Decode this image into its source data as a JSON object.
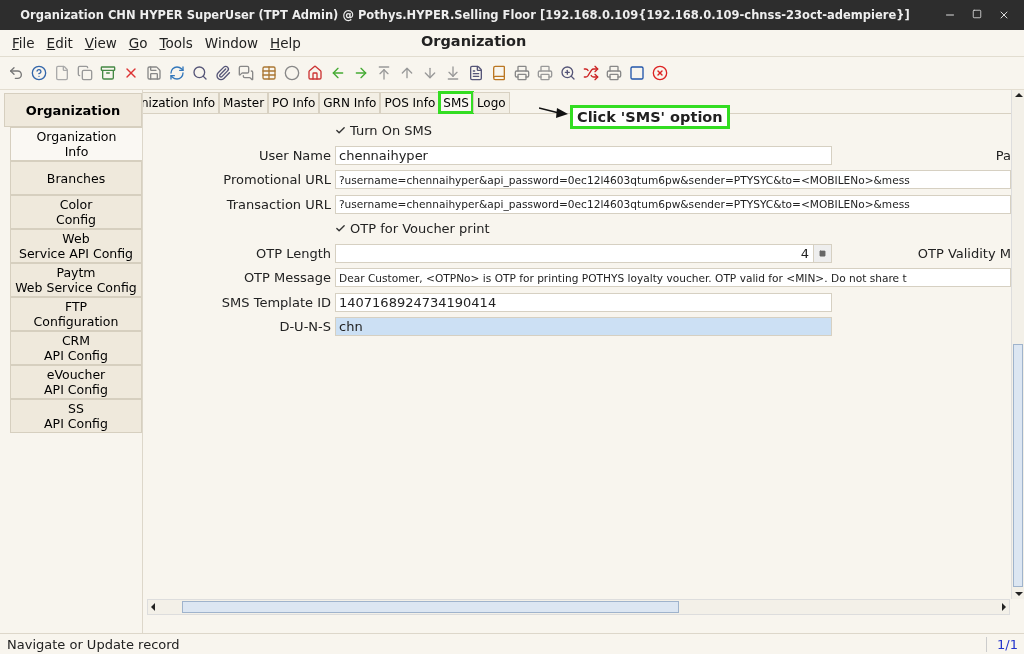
{
  "window": {
    "title": "Organization  CHN  HYPER  SuperUser (TPT Admin) @ Pothys.HYPER.Selling Floor [192.168.0.109{192.168.0.109-chnss-23oct-adempiere}]"
  },
  "menu": [
    {
      "label": "File",
      "mnemonic": true
    },
    {
      "label": "Edit",
      "mnemonic": true
    },
    {
      "label": "View",
      "mnemonic": true
    },
    {
      "label": "Go",
      "mnemonic": true
    },
    {
      "label": "Tools",
      "mnemonic": true
    },
    {
      "label": "Window",
      "mnemonic": false
    },
    {
      "label": "Help",
      "mnemonic": true
    }
  ],
  "window_heading": "Organization",
  "sidebar": {
    "header": "Organization",
    "items": [
      {
        "label": "Organization\nInfo",
        "selected": true
      },
      {
        "label": "Branches",
        "selected": false
      },
      {
        "label": "Color\nConfig",
        "selected": false
      },
      {
        "label": "Web\nService API Config",
        "selected": false
      },
      {
        "label": "Paytm\nWeb Service Config",
        "selected": false
      },
      {
        "label": "FTP\nConfiguration",
        "selected": false
      },
      {
        "label": "CRM\nAPI Config",
        "selected": false
      },
      {
        "label": "eVoucher\nAPI Config",
        "selected": false
      },
      {
        "label": "SS\nAPI Config",
        "selected": false
      }
    ]
  },
  "tabs": [
    {
      "label": "nization Info",
      "selected": false,
      "highlighted": false
    },
    {
      "label": "Master",
      "selected": false,
      "highlighted": false
    },
    {
      "label": "PO Info",
      "selected": false,
      "highlighted": false
    },
    {
      "label": "GRN Info",
      "selected": false,
      "highlighted": false
    },
    {
      "label": "POS Info",
      "selected": false,
      "highlighted": false
    },
    {
      "label": "SMS",
      "selected": true,
      "highlighted": true
    },
    {
      "label": "Logo",
      "selected": false,
      "highlighted": false
    }
  ],
  "callout": "Click 'SMS' option",
  "form": [
    {
      "kind": "checkbox",
      "label": "Turn On SMS",
      "checked": true
    },
    {
      "kind": "text",
      "label": "User Name",
      "value": "chennaihyper",
      "wide": false,
      "focused": false,
      "side_label": "Pa"
    },
    {
      "kind": "text",
      "label": "Promotional URL",
      "value": "?username=chennaihyper&api_password=0ec12l4603qtum6pw&sender=PTYSYC&to=<MOBILENo>&mess",
      "wide": true,
      "focused": false
    },
    {
      "kind": "text",
      "label": "Transaction URL",
      "value": "?username=chennaihyper&api_password=0ec12l4603qtum6pw&sender=PTYSYC&to=<MOBILENo>&mess",
      "wide": true,
      "focused": false
    },
    {
      "kind": "checkbox",
      "label": "OTP for Voucher print",
      "checked": true
    },
    {
      "kind": "number",
      "label": "OTP Length",
      "value": "4",
      "side_label": "OTP Validity M"
    },
    {
      "kind": "text",
      "label": "OTP Message",
      "value": "Dear Customer, <OTPNo> is OTP for printing POTHYS  loyalty voucher. OTP valid for <MIN>. Do not share t",
      "wide": true,
      "focused": false
    },
    {
      "kind": "text",
      "label": "SMS Template ID",
      "value": "1407168924734190414",
      "wide": false,
      "focused": false
    },
    {
      "kind": "text",
      "label": "D-U-N-S",
      "value": "chn",
      "wide": false,
      "focused": true
    }
  ],
  "status_bar": {
    "message": "Navigate or Update record",
    "record": "1/1"
  }
}
